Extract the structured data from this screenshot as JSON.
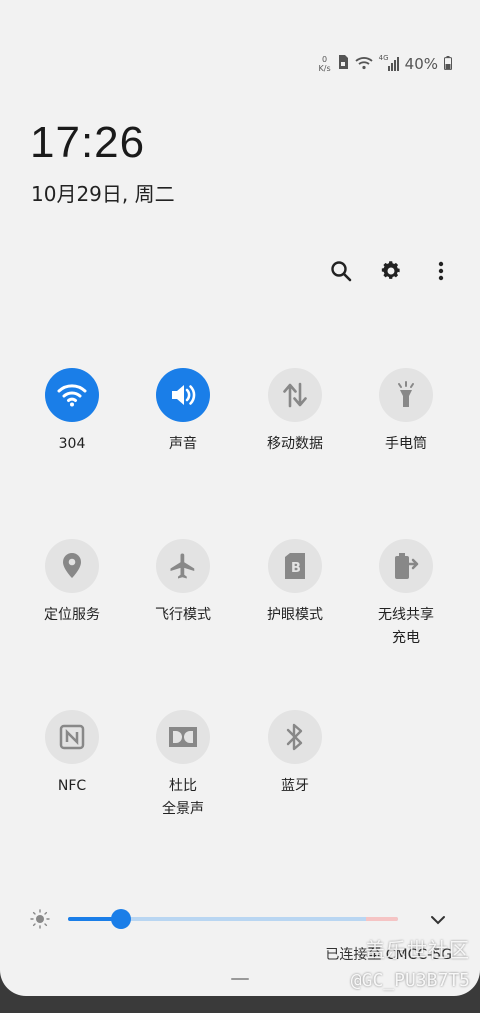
{
  "status_bar": {
    "speed_top": "0",
    "speed_unit": "K/s",
    "network_label": "4G",
    "battery": "40%",
    "icons": [
      "speed-meter-icon",
      "sim-lock-icon",
      "wifi-icon",
      "signal-4g-icon",
      "battery-icon"
    ]
  },
  "clock": {
    "time": "17:26",
    "date": "10月29日, 周二"
  },
  "top_actions": [
    "search-icon",
    "gear-icon",
    "more-vertical-icon"
  ],
  "tiles": [
    {
      "label": "304",
      "icon": "wifi-icon",
      "on": true
    },
    {
      "label": "声音",
      "icon": "volume-icon",
      "on": true
    },
    {
      "label": "移动数据",
      "icon": "mobile-data-icon",
      "on": false
    },
    {
      "label": "手电筒",
      "icon": "flashlight-icon",
      "on": false
    },
    {
      "label": "定位服务",
      "icon": "location-icon",
      "on": false
    },
    {
      "label": "飞行模式",
      "icon": "airplane-icon",
      "on": false
    },
    {
      "label": "护眼模式",
      "icon": "eye-comfort-icon",
      "on": false
    },
    {
      "label": "无线共享\n充电",
      "icon": "wireless-powershare-icon",
      "on": false
    },
    {
      "label": "NFC",
      "icon": "nfc-icon",
      "on": false
    },
    {
      "label": "杜比\n全景声",
      "icon": "dolby-atmos-icon",
      "on": false
    },
    {
      "label": "蓝牙",
      "icon": "bluetooth-icon",
      "on": false
    }
  ],
  "brightness": {
    "level_percent": 16
  },
  "footer": {
    "connected_text": "已连接至 CMCC-5G",
    "watermark_site": "盖乐世社区",
    "watermark_user": "@GC_PU3B7T5"
  },
  "colors": {
    "accent": "#1a7ee8",
    "panel": "#f2f2f2",
    "tile_off": "#e3e3e3"
  }
}
